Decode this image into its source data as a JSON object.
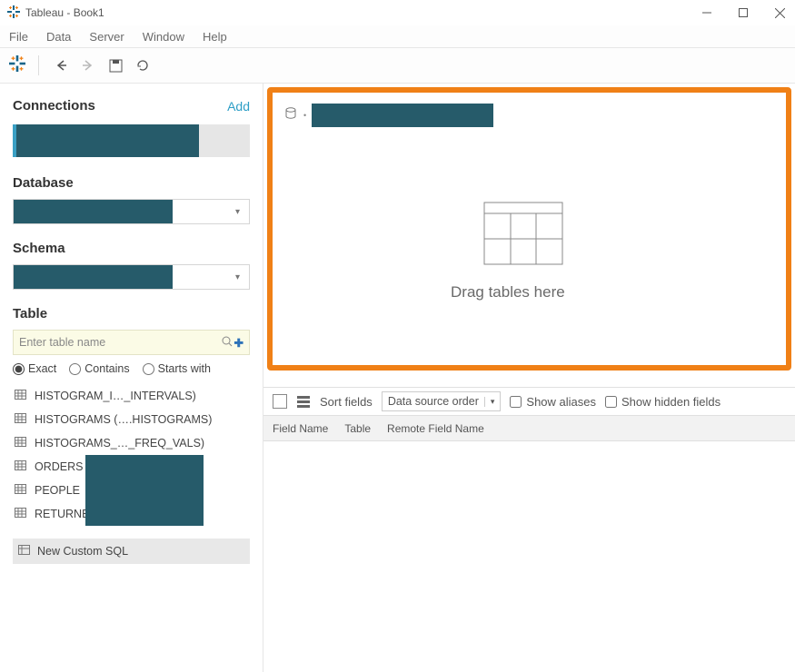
{
  "window": {
    "title": "Tableau - Book1"
  },
  "menu": {
    "items": [
      "File",
      "Data",
      "Server",
      "Window",
      "Help"
    ]
  },
  "sidebar": {
    "connections": {
      "heading": "Connections",
      "add": "Add"
    },
    "database": {
      "heading": "Database"
    },
    "schema": {
      "heading": "Schema"
    },
    "table": {
      "heading": "Table",
      "search_placeholder": "Enter table name",
      "radios": {
        "exact": "Exact",
        "contains": "Contains",
        "starts": "Starts with"
      },
      "items": [
        "HISTOGRAM_I…_INTERVALS)",
        "HISTOGRAMS (….HISTOGRAMS)",
        "HISTOGRAMS_…_FREQ_VALS)",
        "ORDERS",
        "PEOPLE",
        "RETURNED"
      ],
      "custom_sql": "New Custom SQL"
    }
  },
  "canvas": {
    "drop_hint": "Drag tables here"
  },
  "fieldbar": {
    "sort_label": "Sort fields",
    "sort_value": "Data source order",
    "aliases": "Show aliases",
    "hidden": "Show hidden fields"
  },
  "columns": {
    "c1": "Field Name",
    "c2": "Table",
    "c3": "Remote Field Name"
  }
}
